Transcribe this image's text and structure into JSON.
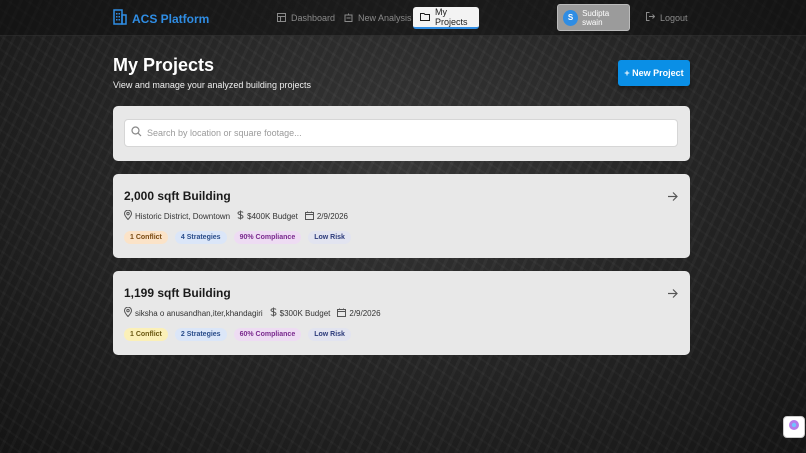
{
  "app": {
    "name": "ACS Platform"
  },
  "nav": {
    "dashboard": "Dashboard",
    "new_analysis": "New Analysis",
    "my_projects": "My Projects",
    "user_initial": "S",
    "user_name": "Sudipta swain",
    "logout": "Logout"
  },
  "header": {
    "title": "My Projects",
    "subtitle": "View and manage your analyzed building projects",
    "new_project": "+ New Project"
  },
  "search": {
    "placeholder": "Search by location or square footage..."
  },
  "projects": [
    {
      "title": "2,000 sqft Building",
      "location": "Historic District, Downtown",
      "budget": "$400K Budget",
      "date": "2/9/2026",
      "conflicts": "1 Conflict",
      "strategies": "4 Strategies",
      "compliance": "90% Compliance",
      "risk": "Low Risk"
    },
    {
      "title": "1,199 sqft Building",
      "location": "siksha o anusandhan,iter,khandagiri",
      "budget": "$300K Budget",
      "date": "2/9/2026",
      "conflicts": "1 Conflict",
      "strategies": "2 Strategies",
      "compliance": "60% Compliance",
      "risk": "Low Risk"
    }
  ]
}
